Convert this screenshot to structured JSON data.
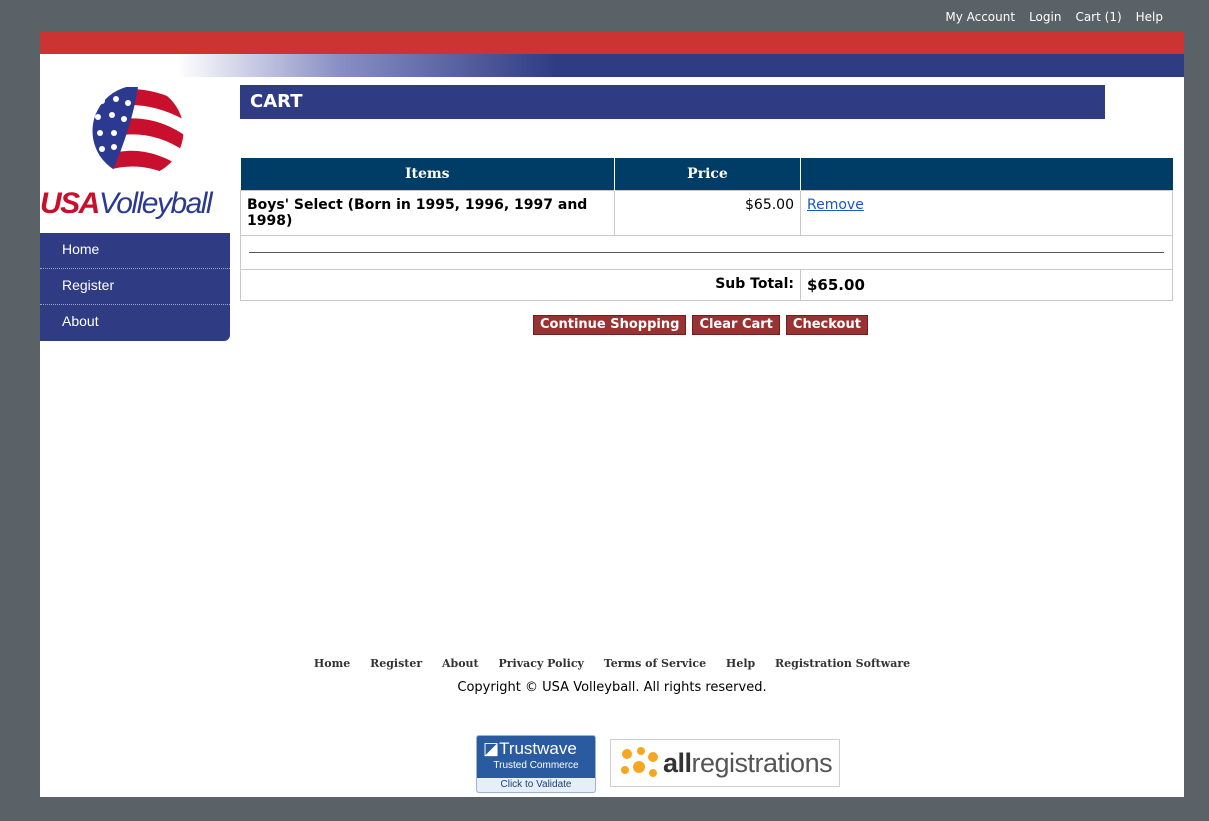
{
  "top_nav": [
    "My Account",
    "Login",
    "Cart (1)",
    "Help"
  ],
  "logo": {
    "usa": "USA",
    "name": "Volleyball"
  },
  "side_nav": [
    "Home",
    "Register",
    "About"
  ],
  "page_title": "CART",
  "cart": {
    "headers": [
      "Items",
      "Price",
      ""
    ],
    "items": [
      {
        "name": "Boys' Select (Born in 1995, 1996, 1997 and 1998)",
        "price": "$65.00",
        "action": "Remove"
      }
    ],
    "subtotal_label": "Sub Total:",
    "subtotal_value": "$65.00"
  },
  "actions": {
    "continue": "Continue Shopping",
    "clear": "Clear Cart",
    "checkout": "Checkout"
  },
  "footer": {
    "links": [
      "Home",
      "Register",
      "About",
      "Privacy Policy",
      "Terms of Service",
      "Help",
      "Registration Software"
    ],
    "copyright": "Copyright © USA Volleyball. All rights reserved."
  },
  "badges": {
    "trustwave_title": "Trustwave",
    "trustwave_sub": "Trusted Commerce",
    "trustwave_validate": "Click to Validate",
    "allreg_bold": "all",
    "allreg_rest": "registrations"
  },
  "colors": {
    "red": "#cc3333",
    "navy": "#2f3c84",
    "table_header": "#003d66",
    "button": "#993333"
  }
}
